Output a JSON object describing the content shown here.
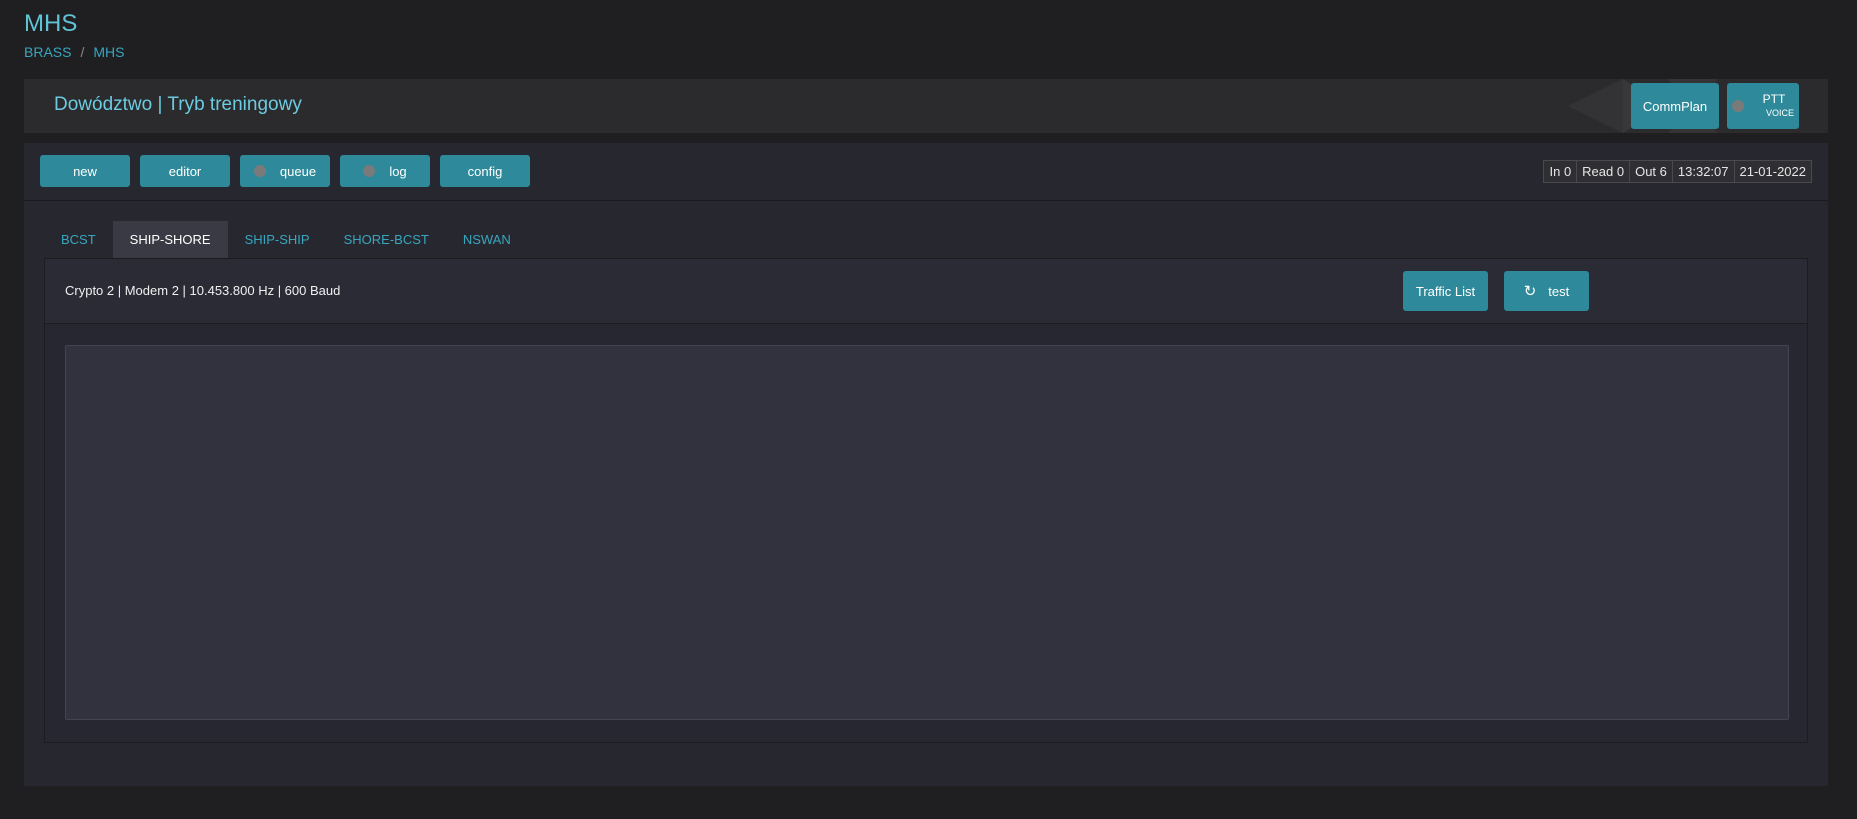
{
  "app": {
    "title": "MHS"
  },
  "breadcrumb": {
    "items": [
      "BRASS",
      "MHS"
    ],
    "separator": "/"
  },
  "header": {
    "title": "Dowództwo | Tryb treningowy",
    "commplan_label": "CommPlan",
    "ptt_label": "PTT",
    "ptt_sub_label": "VOICE"
  },
  "toolbar": {
    "new_label": "new",
    "editor_label": "editor",
    "queue_label": "queue",
    "log_label": "log",
    "config_label": "config"
  },
  "status": {
    "in": "In 0",
    "read": "Read 0",
    "out": "Out 6",
    "time": "13:32:07",
    "date": "21-01-2022"
  },
  "tabs": [
    {
      "label": "BCST"
    },
    {
      "label": "SHIP-SHORE",
      "active": true
    },
    {
      "label": "SHIP-SHIP"
    },
    {
      "label": "SHORE-BCST"
    },
    {
      "label": "NSWAN"
    }
  ],
  "panel": {
    "radio_info": "Crypto 2 | Modem 2 | 10.453.800 Hz | 600 Baud",
    "traffic_list_label": "Traffic List",
    "test_label": "test",
    "message_text": ""
  },
  "colors": {
    "accent": "#2e8a9a",
    "link": "#38a6bf",
    "background": "#1f1f21",
    "panel": "#27282f"
  },
  "icons": [
    "refresh-icon",
    "status-dot-icon"
  ]
}
